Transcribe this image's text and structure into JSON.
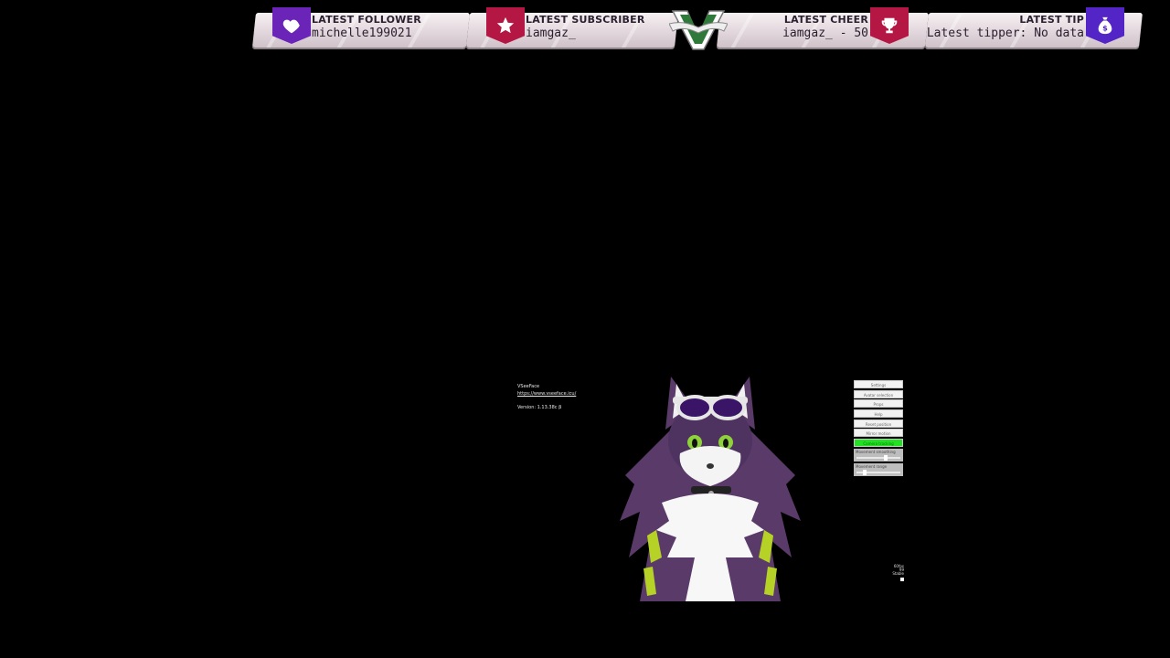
{
  "alerts": {
    "follower": {
      "label": "LATEST FOLLOWER",
      "value": "michelle199021",
      "icon": "heart-icon",
      "color": "#6a24b8"
    },
    "subscriber": {
      "label": "LATEST SUBSCRIBER",
      "value": "iamgaz_",
      "icon": "star-icon",
      "color": "#b51744"
    },
    "cheer": {
      "label": "LATEST CHEER",
      "value": "iamgaz_ - 50",
      "icon": "trophy-icon",
      "color": "#b51744"
    },
    "tip": {
      "label": "LATEST TIP",
      "value": "Latest tipper: No data",
      "icon": "money-bag-icon",
      "color": "#5425c6"
    },
    "center_logo": "V"
  },
  "vseeface": {
    "app_name": "VSeeFace",
    "url": "https://www.vseeface.icu/",
    "version": "Version: 1.13.38c β",
    "menu": [
      {
        "label": "Settings",
        "active": false
      },
      {
        "label": "Avatar selection",
        "active": false
      },
      {
        "label": "Props",
        "active": false
      },
      {
        "label": "Help",
        "active": false
      },
      {
        "label": "Reset position",
        "active": false
      },
      {
        "label": "Mirror motion",
        "active": false
      },
      {
        "label": "Camera tracking",
        "active": true
      }
    ],
    "sliders": [
      {
        "label": "Movement smoothing",
        "value": 0.7
      },
      {
        "label": "Movement range",
        "value": 0.2
      }
    ],
    "stats": [
      "60fps",
      "99",
      "Stable"
    ]
  }
}
